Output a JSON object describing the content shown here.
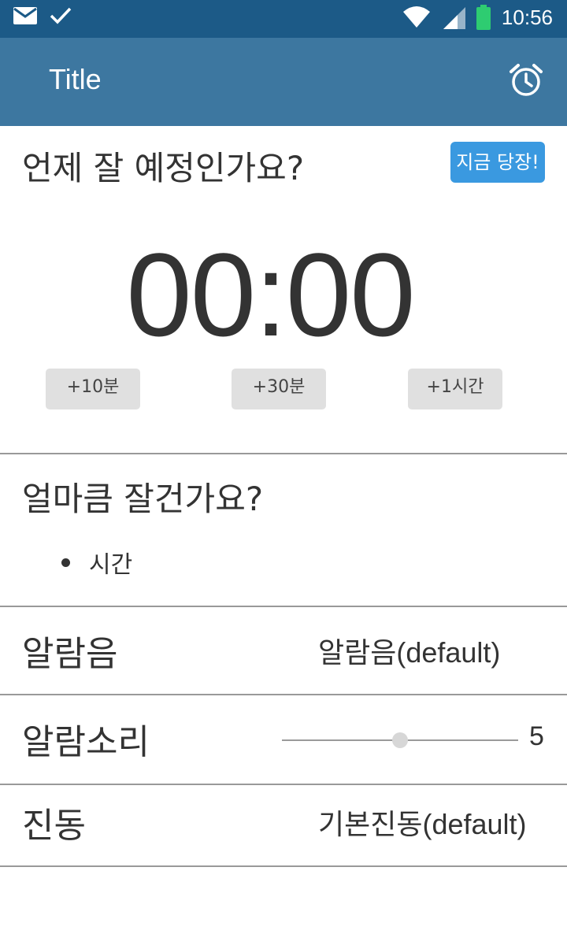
{
  "status_bar": {
    "time": "10:56",
    "left_icons": [
      "mail-icon",
      "check-icon"
    ],
    "right_icons": [
      "wifi-icon",
      "signal-icon",
      "battery-icon"
    ],
    "battery_color": "#2ecc71",
    "background": "#1c5a87"
  },
  "app_bar": {
    "title": "Title",
    "action_icon": "alarm-clock-icon",
    "background": "#3d77a0"
  },
  "schedule": {
    "question": "언제 잘 예정인가요?",
    "now_button": "지금 당장!",
    "now_button_color": "#3a99e0",
    "time": "00:00",
    "add_buttons": [
      "+10분",
      "+30분",
      "+1시간"
    ]
  },
  "duration": {
    "question": "얼마큼 잘건가요?",
    "options": [
      "시간"
    ]
  },
  "alarm_sound": {
    "label": "알람음",
    "value": "알람음(default)"
  },
  "alarm_volume": {
    "label": "알람소리",
    "value": "5",
    "level": 0.5
  },
  "vibration": {
    "label": "진동",
    "value": "기본진동(default)"
  }
}
